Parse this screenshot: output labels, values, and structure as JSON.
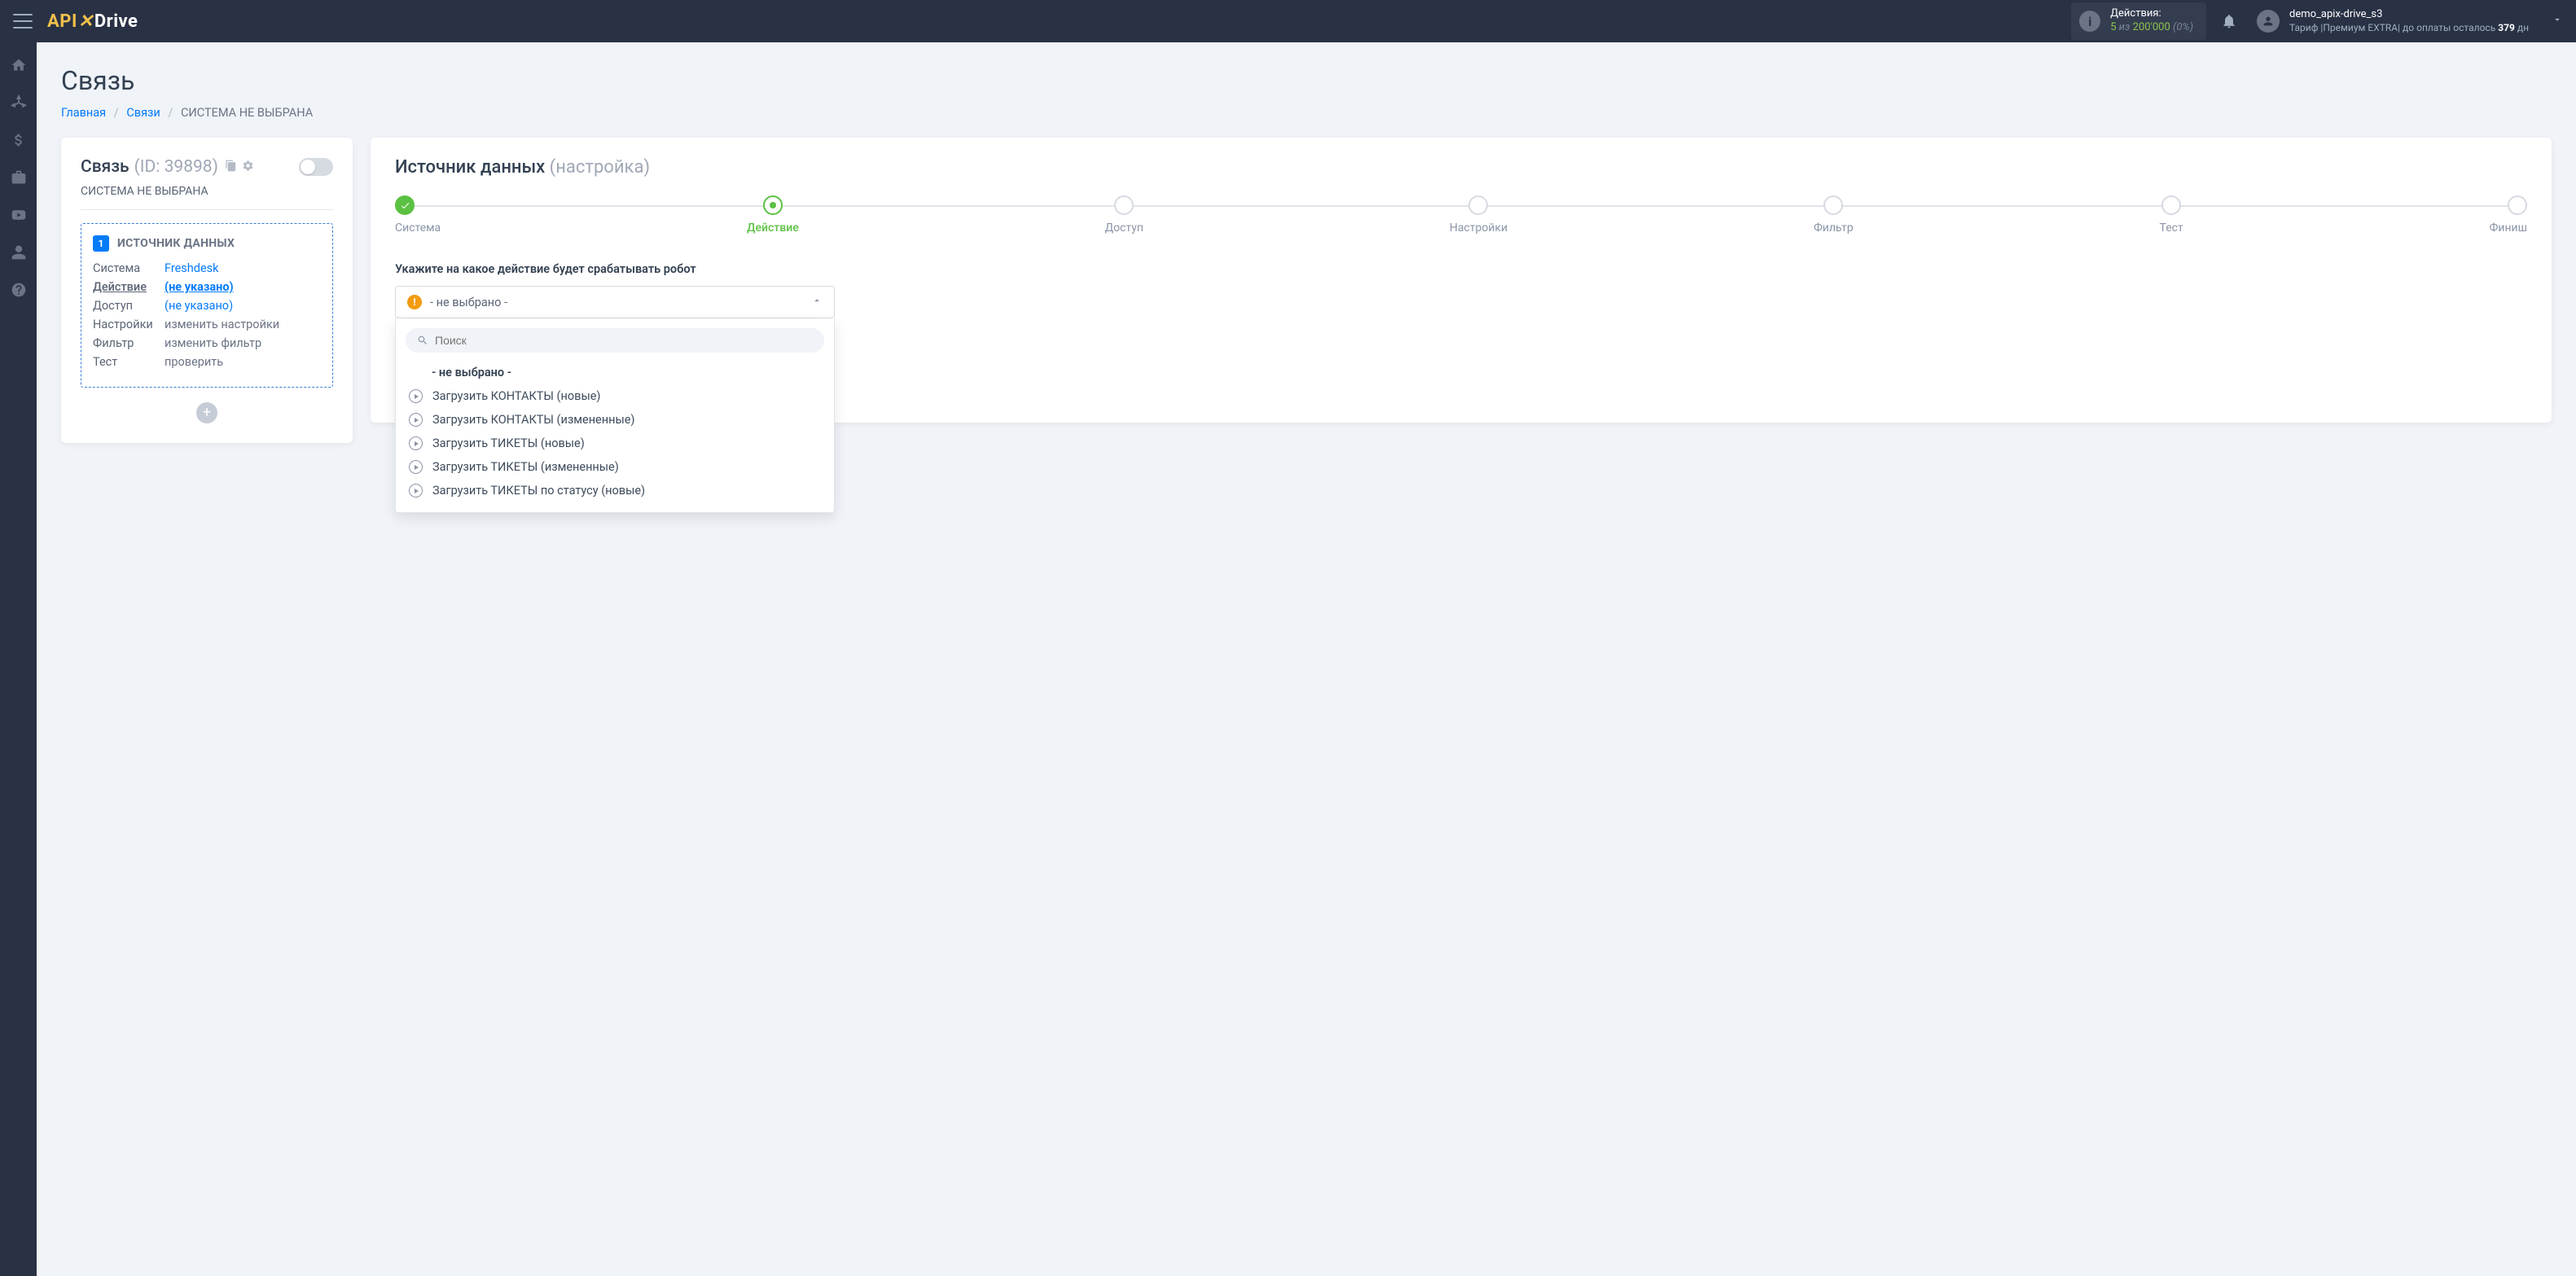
{
  "topbar": {
    "actions_label": "Действия:",
    "actions_count": "5",
    "actions_of": "из",
    "actions_total": "200'000",
    "actions_pct": "(0%)",
    "user": "demo_apix-drive_s3",
    "tariff_prefix": "Тариф |",
    "tariff_name": "Премиум EXTRA",
    "pay_text": "| до оплаты осталось ",
    "pay_days": "379",
    "pay_unit": "дн"
  },
  "page": {
    "title": "Связь",
    "breadcrumb": {
      "home": "Главная",
      "links": "Связи",
      "current": "СИСТЕМА НЕ ВЫБРАНА"
    }
  },
  "left": {
    "title": "Связь",
    "id_label": "(ID: 39898)",
    "subsystem": "СИСТЕМА НЕ ВЫБРАНА",
    "source": {
      "badge": "1",
      "header": "ИСТОЧНИК ДАННЫХ",
      "rows": [
        {
          "k": "Система",
          "v": "Freshdesk",
          "link": true
        },
        {
          "k": "Действие",
          "v": "(не указано)",
          "link": true,
          "active": true
        },
        {
          "k": "Доступ",
          "v": "(не указано)",
          "link": true
        },
        {
          "k": "Настройки",
          "v": "изменить настройки",
          "muted": true
        },
        {
          "k": "Фильтр",
          "v": "изменить фильтр",
          "muted": true
        },
        {
          "k": "Тест",
          "v": "проверить",
          "muted": true
        }
      ]
    }
  },
  "right": {
    "title": "Источник данных",
    "subtitle": "(настройка)",
    "steps": [
      "Система",
      "Действие",
      "Доступ",
      "Настройки",
      "Фильтр",
      "Тест",
      "Финиш"
    ],
    "label": "Укажите на какое действие будет срабатывать робот",
    "selected": "- не выбрано -",
    "search_placeholder": "Поиск",
    "none_option": "- не выбрано -",
    "options": [
      "Загрузить КОНТАКТЫ (новые)",
      "Загрузить КОНТАКТЫ (измененные)",
      "Загрузить ТИКЕТЫ (новые)",
      "Загрузить ТИКЕТЫ (измененные)",
      "Загрузить ТИКЕТЫ по статусу (новые)"
    ]
  }
}
